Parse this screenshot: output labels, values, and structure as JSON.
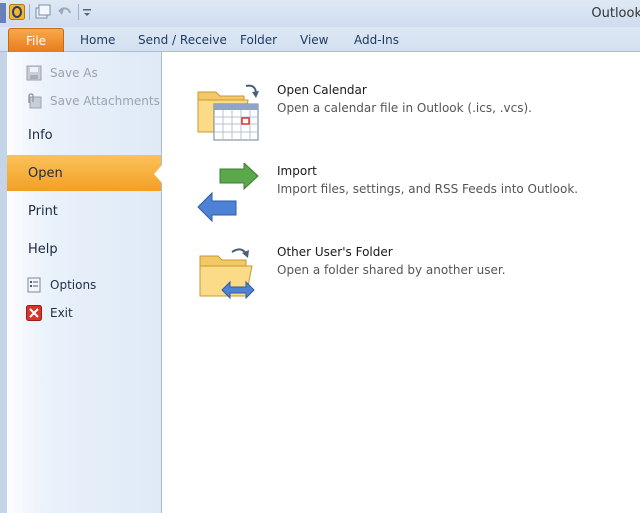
{
  "window": {
    "title": "Outlook"
  },
  "ribbon": {
    "file_tab": "File",
    "tabs": [
      "Home",
      "Send / Receive",
      "Folder",
      "View",
      "Add-Ins"
    ]
  },
  "backstage": {
    "commands_top": [
      {
        "label": "Save As",
        "icon": "save-as-icon",
        "enabled": false
      },
      {
        "label": "Save Attachments",
        "icon": "save-attachments-icon",
        "enabled": false
      }
    ],
    "tabs": [
      "Info",
      "Open",
      "Print",
      "Help"
    ],
    "selected_tab": "Open",
    "commands_bottom": [
      {
        "label": "Options",
        "icon": "options-icon"
      },
      {
        "label": "Exit",
        "icon": "exit-icon"
      }
    ]
  },
  "open_panel": {
    "items": [
      {
        "title": "Open Calendar",
        "description": "Open a calendar file in Outlook (.ics, .vcs).",
        "icon": "open-calendar-icon"
      },
      {
        "title": "Import",
        "description": "Import files, settings, and RSS Feeds into Outlook.",
        "icon": "import-icon"
      },
      {
        "title": "Other User's Folder",
        "description": "Open a folder shared by another user.",
        "icon": "other-users-folder-icon"
      }
    ]
  },
  "colors": {
    "file_tab": "#e9791a",
    "selected_nav": "#f2a024",
    "nav_bg": "#dfeaf7"
  }
}
